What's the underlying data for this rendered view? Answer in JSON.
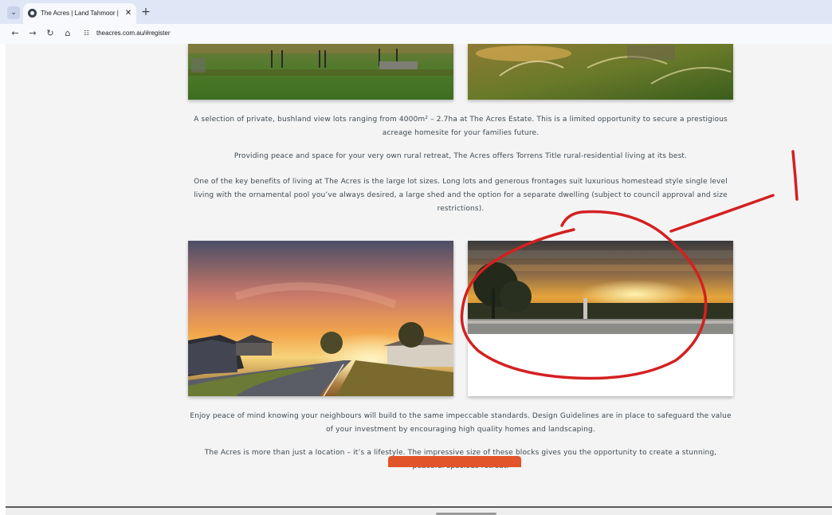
{
  "browser": {
    "tab": {
      "title": "The Acres | Land Tahmoor | Big",
      "close": "✕",
      "favicon": "globe-icon"
    },
    "tab_list": "⌄",
    "new_tab": "+",
    "toolbar": {
      "back": "←",
      "forward": "→",
      "reload": "↻",
      "home": "⌂",
      "site_info": "☷",
      "url": "theacres.com.au/#register"
    }
  },
  "content": {
    "paragraphs_top": [
      "A selection of private, bushland view lots ranging from 4000m² – 2.7ha at The Acres Estate. This is a limited opportunity to secure a prestigious acreage homesite for your families future.",
      "Providing peace and space for your very own rural retreat, The Acres offers Torrens Title rural-residential living at its best.",
      "One of the key benefits of living at The Acres is the large lot sizes. Long lots and generous frontages suit luxurious homestead style single level living with the ornamental pool you’ve always desired, a large shed and the option for a separate dwelling (subject to council approval and size restrictions)."
    ],
    "paragraphs_bottom": [
      "Enjoy peace of mind knowing your neighbours will build to the same impeccable standards.  Design Guidelines are in place to safeguard the value of your investment by encouraging high quality homes and landscaping.",
      "The Acres is more than just a location – it’s a lifestyle. The impressive size of these blocks gives you the opportunity to create a stunning, peaceful spacious retreat."
    ]
  },
  "colors": {
    "accent": "#e2542a",
    "annotation": "#d42020",
    "tabstrip": "#dfe6f6",
    "page_bg": "#f4f4f4"
  }
}
